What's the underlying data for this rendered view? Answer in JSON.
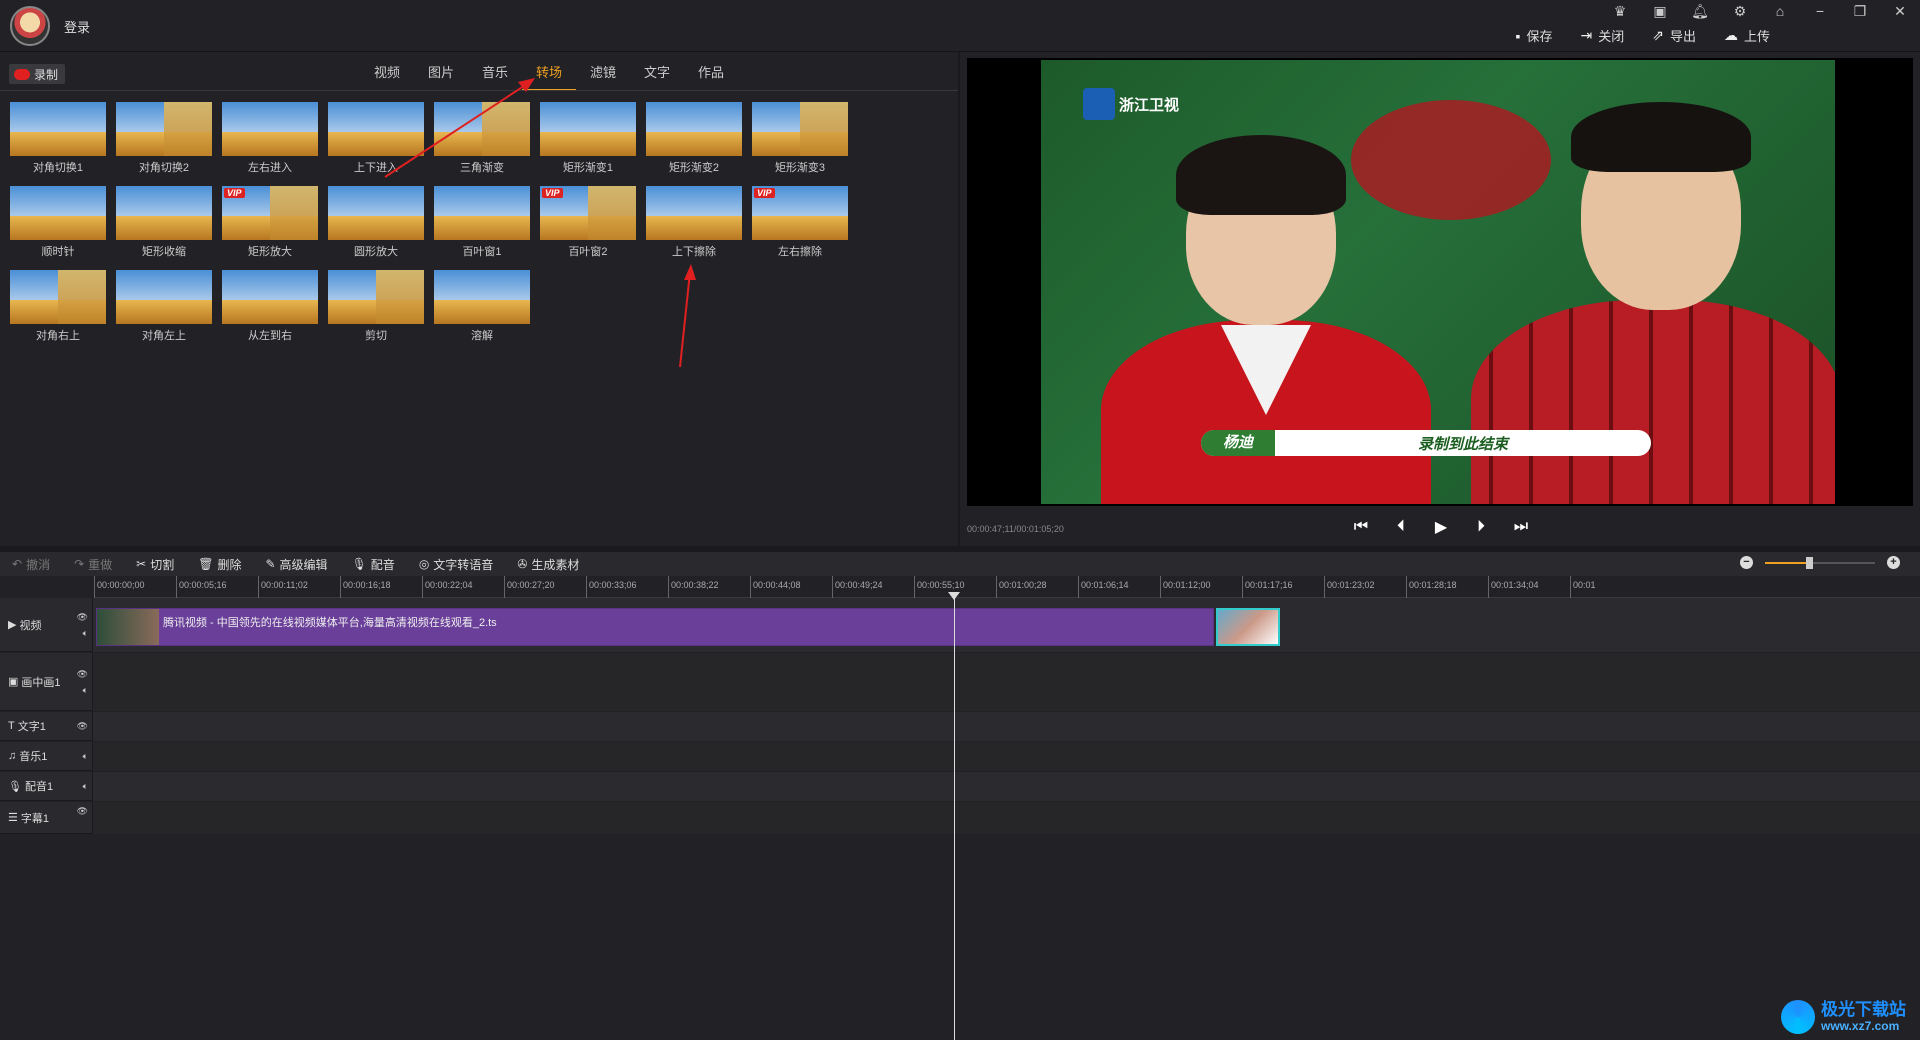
{
  "header": {
    "login": "登录"
  },
  "window_controls": [
    "crown-icon",
    "screen-icon",
    "bell-icon",
    "gear-icon",
    "skin-icon",
    "minimize-icon",
    "restore-icon",
    "close-icon"
  ],
  "actions": [
    {
      "label": "保存",
      "icon": "save-icon"
    },
    {
      "label": "关闭",
      "icon": "close-doc-icon"
    },
    {
      "label": "导出",
      "icon": "export-icon"
    },
    {
      "label": "上传",
      "icon": "upload-icon"
    }
  ],
  "record": {
    "label": "录制"
  },
  "tabs": [
    {
      "label": "视频",
      "active": false
    },
    {
      "label": "图片",
      "active": false
    },
    {
      "label": "音乐",
      "active": false
    },
    {
      "label": "转场",
      "active": true
    },
    {
      "label": "滤镜",
      "active": false
    },
    {
      "label": "文字",
      "active": false
    },
    {
      "label": "作品",
      "active": false
    }
  ],
  "transitions": [
    {
      "label": "对角切换1",
      "vip": false
    },
    {
      "label": "对角切换2",
      "vip": false
    },
    {
      "label": "左右进入",
      "vip": false
    },
    {
      "label": "上下进入",
      "vip": false
    },
    {
      "label": "三角渐变",
      "vip": false
    },
    {
      "label": "矩形渐变1",
      "vip": false
    },
    {
      "label": "矩形渐变2",
      "vip": false
    },
    {
      "label": "矩形渐变3",
      "vip": false
    },
    {
      "label": "顺时针",
      "vip": false
    },
    {
      "label": "矩形收缩",
      "vip": false
    },
    {
      "label": "矩形放大",
      "vip": true
    },
    {
      "label": "圆形放大",
      "vip": false
    },
    {
      "label": "百叶窗1",
      "vip": false
    },
    {
      "label": "百叶窗2",
      "vip": true
    },
    {
      "label": "上下擦除",
      "vip": false
    },
    {
      "label": "左右擦除",
      "vip": true
    },
    {
      "label": "对角右上",
      "vip": false
    },
    {
      "label": "对角左上",
      "vip": false
    },
    {
      "label": "从左到右",
      "vip": false
    },
    {
      "label": "剪切",
      "vip": false
    },
    {
      "label": "溶解",
      "vip": false
    }
  ],
  "vip_label": "VIP",
  "preview": {
    "channel_logo": "浙江卫视",
    "lower_third_name": "杨迪",
    "lower_third_text": "录制到此结束",
    "timecode": "00:00:47;11/00:01:05;20"
  },
  "transport": [
    "skip-start-icon",
    "step-back-icon",
    "play-icon",
    "step-forward-icon",
    "skip-end-icon"
  ],
  "toolbar": [
    {
      "label": "撤消",
      "icon": "undo-icon",
      "enabled": false
    },
    {
      "label": "重做",
      "icon": "redo-icon",
      "enabled": false
    },
    {
      "label": "切割",
      "icon": "scissors-icon",
      "enabled": true
    },
    {
      "label": "删除",
      "icon": "trash-icon",
      "enabled": true
    },
    {
      "label": "高级编辑",
      "icon": "pencil-icon",
      "enabled": true
    },
    {
      "label": "配音",
      "icon": "mic-icon",
      "enabled": true
    },
    {
      "label": "文字转语音",
      "icon": "tts-icon",
      "enabled": true
    },
    {
      "label": "生成素材",
      "icon": "film-reel-icon",
      "enabled": true
    }
  ],
  "zoom": {
    "level": 0.4
  },
  "ruler": [
    "00:00:00;00",
    "00:00:05;16",
    "00:00:11;02",
    "00:00:16;18",
    "00:00:22;04",
    "00:00:27;20",
    "00:00:33;06",
    "00:00:38;22",
    "00:00:44;08",
    "00:00:49;24",
    "00:00:55;10",
    "00:01:00;28",
    "00:01:06;14",
    "00:01:12;00",
    "00:01:17;16",
    "00:01:23;02",
    "00:01:28;18",
    "00:01:34;04",
    "00:01"
  ],
  "tracks": [
    {
      "label": "视频",
      "icon": "play-square-icon"
    },
    {
      "label": "画中画1",
      "icon": "pip-icon"
    },
    {
      "label": "文字1",
      "icon": "text-icon"
    },
    {
      "label": "音乐1",
      "icon": "music-icon"
    },
    {
      "label": "配音1",
      "icon": "mic-icon"
    },
    {
      "label": "字幕1",
      "icon": "subtitle-icon"
    }
  ],
  "clip": {
    "title": "腾讯视频 - 中国领先的在线视频媒体平台,海量高清视频在线观看_2.ts"
  },
  "watermark": {
    "line1": "极光下载站",
    "line2": "www.xz7.com"
  },
  "colors": {
    "accent": "#f0a020",
    "clip": "#6a3f9a",
    "record": "#e02020"
  }
}
